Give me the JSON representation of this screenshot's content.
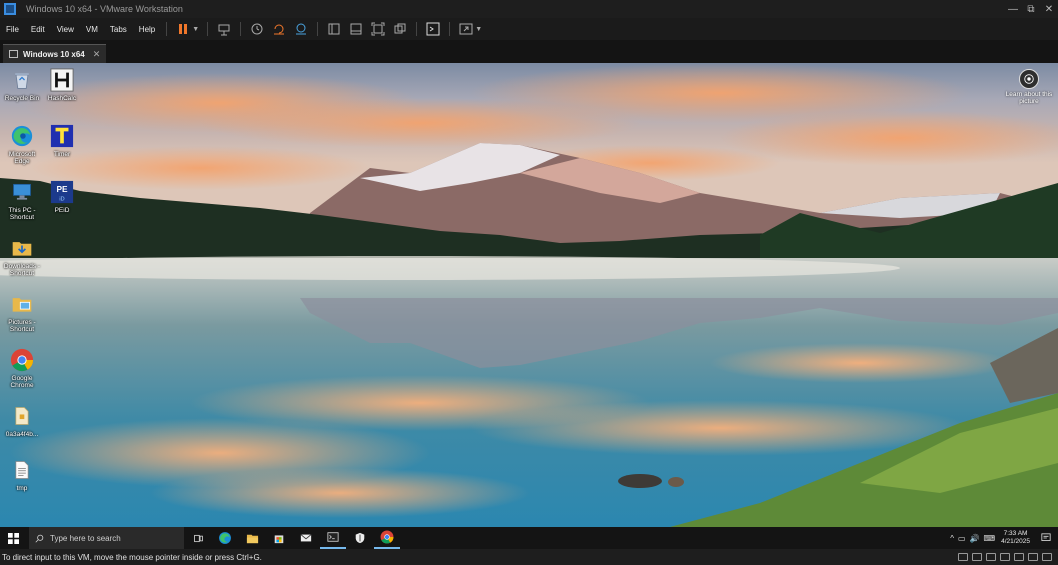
{
  "window": {
    "title": "Windows 10 x64 - VMware Workstation",
    "controls": [
      "—",
      "⧉",
      "✕"
    ]
  },
  "menu": {
    "file": "File",
    "edit": "Edit",
    "view": "View",
    "vm": "VM",
    "tabs": "Tabs",
    "help": "Help"
  },
  "toolbar": {
    "icons": [
      "pause-icon",
      "send-keys-icon",
      "snapshot-icon",
      "revert-snapshot-icon",
      "snapshot-manager-icon",
      "show-library-icon",
      "thumbnail-bar-icon",
      "full-screen-icon",
      "unity-icon",
      "console-view-icon",
      "stretch-icon"
    ]
  },
  "tab": {
    "label": "Windows 10 x64",
    "close": "✕"
  },
  "desktop": {
    "icons": [
      {
        "label": "Recycle Bin",
        "icon": "recycle-bin-icon"
      },
      {
        "label": "HashCalc",
        "icon": "hashcalc-icon"
      },
      {
        "label": "Microsoft\nEdge",
        "icon": "edge-icon"
      },
      {
        "label": "Timer",
        "icon": "timer-icon"
      },
      {
        "label": "This PC -\nShortcut",
        "icon": "this-pc-icon"
      },
      {
        "label": "PEiD",
        "icon": "peid-icon"
      },
      {
        "label": "Downloads -\nShortcut",
        "icon": "downloads-icon"
      },
      {
        "label": "Pictures -\nShortcut",
        "icon": "pictures-icon"
      },
      {
        "label": "Google\nChrome",
        "icon": "chrome-icon"
      },
      {
        "label": "0a3a4f4b...",
        "icon": "file-icon"
      },
      {
        "label": "tmp",
        "icon": "text-file-icon"
      }
    ],
    "learn_label": "Learn about\nthis picture"
  },
  "taskbar": {
    "search_placeholder": "Type here to search",
    "time": "7:33 AM",
    "date": "4/21/2025",
    "apps": [
      "task-view-icon",
      "edge-icon",
      "file-explorer-icon",
      "store-icon",
      "mail-icon",
      "terminal-icon",
      "security-icon",
      "chrome-icon"
    ],
    "tray_glyphs": [
      "^",
      "▭",
      "🔊",
      "⌨"
    ]
  },
  "statusbar": {
    "message": "To direct input to this VM, move the mouse pointer inside or press Ctrl+G."
  },
  "colors": {
    "title_bg": "#1e1e1e",
    "menu_bg": "#1b1b1b",
    "taskbar_bg": "#141414",
    "accent": "#76b9ed",
    "pause_orange": "#f0772b"
  }
}
